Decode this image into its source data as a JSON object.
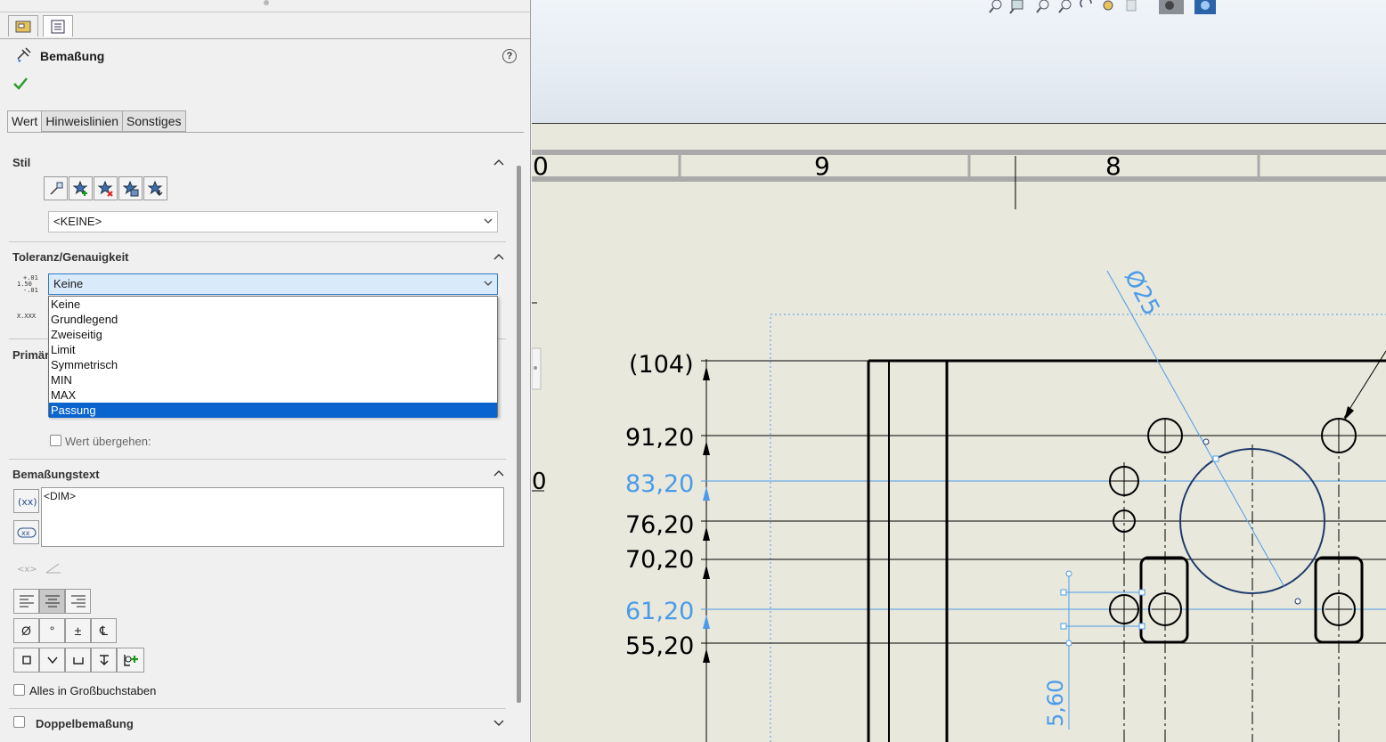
{
  "panel": {
    "title": "Bemaßung",
    "tabs": [
      {
        "label": "Wert",
        "active": true
      },
      {
        "label": "Hinweislinien",
        "active": false
      },
      {
        "label": "Sonstiges",
        "active": false
      }
    ],
    "style_section": {
      "heading": "Stil",
      "combo_value": "<KEINE>"
    },
    "tolerance_section": {
      "heading": "Toleranz/Genauigkeit",
      "combo_value": "Keine",
      "icon_sample_top": "1.50",
      "icon_sample_plus": "+.01",
      "icon_sample_minus": "-.01",
      "icon_sample2": "X.XXX",
      "options": [
        "Keine",
        "Grundlegend",
        "Zweiseitig",
        "Limit",
        "Symmetrisch",
        "MIN",
        "MAX",
        "Passung"
      ],
      "highlighted_option": "Passung"
    },
    "primary_section": {
      "heading": "Primär",
      "override_label": "Wert übergehen:"
    },
    "dimtext_section": {
      "heading": "Bemaßungstext",
      "text": "<DIM>"
    },
    "symbols": {
      "row1": [
        "Ø",
        "°",
        "±",
        "℄"
      ]
    },
    "uppercase_label": "Alles in Großbuchstaben",
    "dual_label": "Doppelbemaßung"
  },
  "drawing": {
    "zone_labels": [
      "0",
      "9",
      "8"
    ],
    "dimensions_black": [
      "(104)",
      "91,20",
      "76,20",
      "70,20",
      "55,20"
    ],
    "dimensions_blue": [
      "83,20",
      "61,20"
    ],
    "diameter_label": "Ø25",
    "vertical_dim": "5,60",
    "left_partial": "0",
    "colors": {
      "selected_blue": "#4b9be8",
      "sheet_bg": "#e9e8dd",
      "line": "#000000",
      "dropdown_selection": "#0a64d0"
    }
  }
}
